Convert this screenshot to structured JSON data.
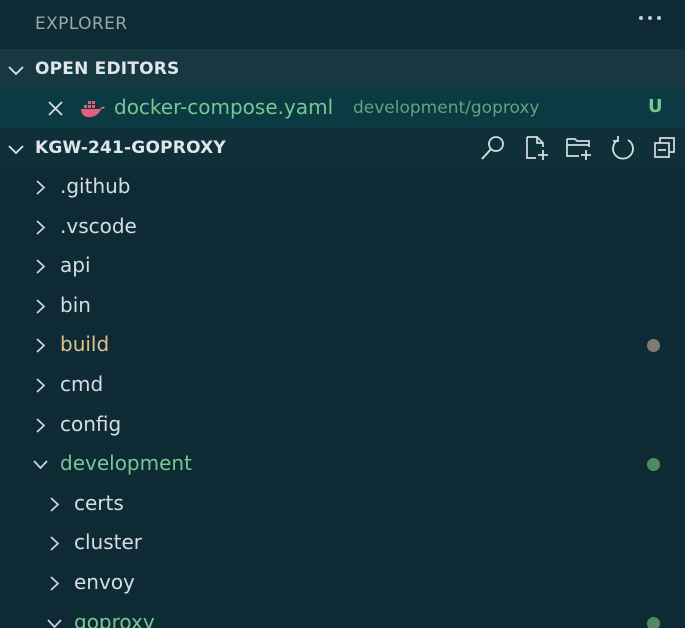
{
  "explorer": {
    "title": "EXPLORER"
  },
  "open_editors": {
    "header": "OPEN EDITORS",
    "items": [
      {
        "filename": "docker-compose.yaml",
        "path": "development/goproxy",
        "badge": "U",
        "icon": "docker-icon"
      }
    ]
  },
  "project": {
    "header": "KGW-241-GOPROXY",
    "toolbar": [
      "search-icon",
      "new-file-icon",
      "new-folder-icon",
      "refresh-icon",
      "collapse-all-icon"
    ]
  },
  "tree": [
    {
      "label": ".github",
      "depth": 0,
      "expanded": false,
      "status": "none"
    },
    {
      "label": ".vscode",
      "depth": 0,
      "expanded": false,
      "status": "none"
    },
    {
      "label": "api",
      "depth": 0,
      "expanded": false,
      "status": "none"
    },
    {
      "label": "bin",
      "depth": 0,
      "expanded": false,
      "status": "none"
    },
    {
      "label": "build",
      "depth": 0,
      "expanded": false,
      "status": "modified"
    },
    {
      "label": "cmd",
      "depth": 0,
      "expanded": false,
      "status": "none"
    },
    {
      "label": "config",
      "depth": 0,
      "expanded": false,
      "status": "none"
    },
    {
      "label": "development",
      "depth": 0,
      "expanded": true,
      "status": "untracked"
    },
    {
      "label": "certs",
      "depth": 1,
      "expanded": false,
      "status": "none"
    },
    {
      "label": "cluster",
      "depth": 1,
      "expanded": false,
      "status": "none"
    },
    {
      "label": "envoy",
      "depth": 1,
      "expanded": false,
      "status": "none"
    },
    {
      "label": "goproxy",
      "depth": 1,
      "expanded": true,
      "status": "untracked"
    }
  ],
  "colors": {
    "background": "#0e2b35",
    "text": "#d5dde0",
    "untracked": "#73c991",
    "modified": "#e2c08d",
    "dot_untracked": "#4f8a63",
    "dot_modified": "#7c7c73"
  }
}
